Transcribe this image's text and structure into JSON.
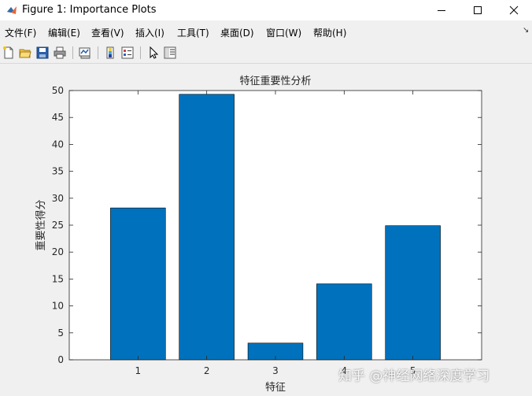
{
  "window": {
    "title": "Figure 1: Importance Plots"
  },
  "menu": {
    "items": [
      "文件(F)",
      "编辑(E)",
      "查看(V)",
      "插入(I)",
      "工具(T)",
      "桌面(D)",
      "窗口(W)",
      "帮助(H)"
    ]
  },
  "toolbar": {
    "icons": [
      "new-figure-icon",
      "open-file-icon",
      "save-icon",
      "print-icon",
      "link-plot-icon",
      "insert-colorbar-icon",
      "insert-legend-icon",
      "edit-plot-arrow-icon",
      "property-inspector-icon"
    ]
  },
  "colors": {
    "bar": "#0072BD",
    "axes_bg": "#ffffff",
    "figure_bg": "#f0f0f0"
  },
  "watermark": "知乎 @神经网络深度学习",
  "chart_data": {
    "type": "bar",
    "title": "特征重要性分析",
    "xlabel": "特征",
    "ylabel": "重要性得分",
    "categories": [
      "1",
      "2",
      "3",
      "4",
      "5"
    ],
    "values": [
      28.2,
      49.3,
      3.1,
      14.1,
      24.9
    ],
    "xlim": [
      0,
      6
    ],
    "ylim": [
      0,
      50
    ],
    "yticks": [
      0,
      5,
      10,
      15,
      20,
      25,
      30,
      35,
      40,
      45,
      50
    ],
    "grid": false
  }
}
